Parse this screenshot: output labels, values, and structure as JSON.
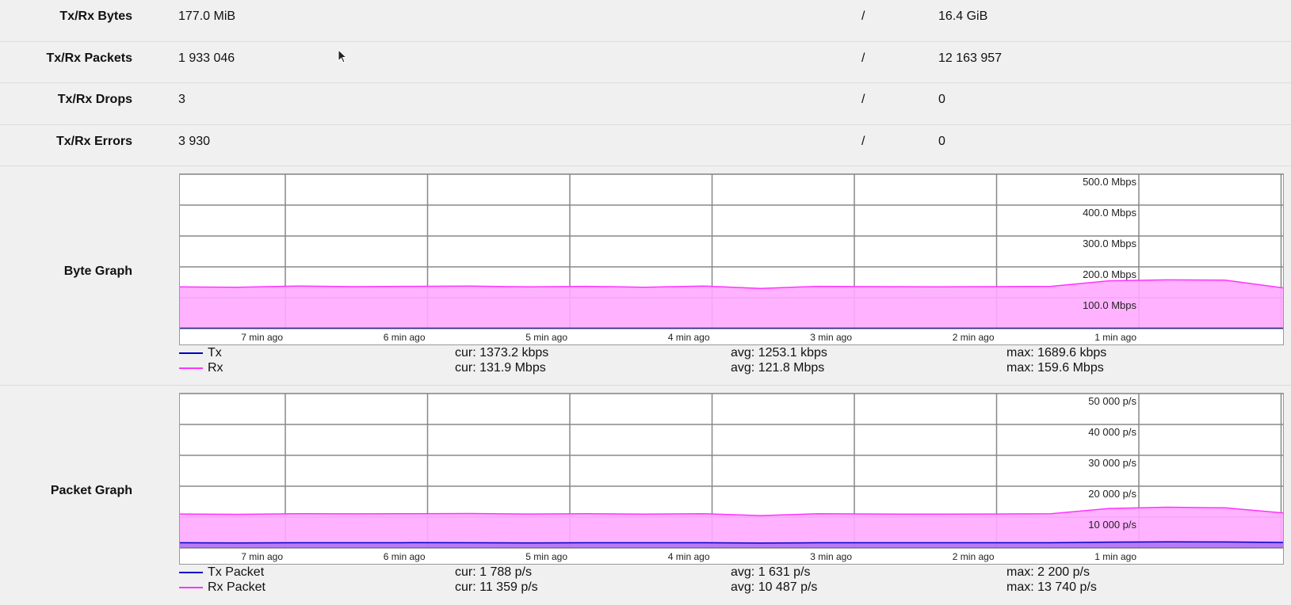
{
  "stats": [
    {
      "label": "Tx/Rx Bytes",
      "tx": "177.0 MiB",
      "sep": "/",
      "rx": "16.4 GiB"
    },
    {
      "label": "Tx/Rx Packets",
      "tx": "1 933 046",
      "sep": "/",
      "rx": "12 163 957"
    },
    {
      "label": "Tx/Rx Drops",
      "tx": "3",
      "sep": "/",
      "rx": "0"
    },
    {
      "label": "Tx/Rx Errors",
      "tx": "3 930",
      "sep": "/",
      "rx": "0"
    }
  ],
  "colors": {
    "tx": "#0000cc",
    "rx": "#ff33ff",
    "rx_fill": "#ffaaff",
    "grid": "#888888"
  },
  "byte_graph": {
    "label": "Byte Graph",
    "y_ticks": [
      "500.0 Mbps",
      "400.0 Mbps",
      "300.0 Mbps",
      "200.0 Mbps",
      "100.0 Mbps"
    ],
    "x_ticks": [
      "7 min ago",
      "6 min ago",
      "5 min ago",
      "4 min ago",
      "3 min ago",
      "2 min ago",
      "1 min ago"
    ],
    "legend": [
      {
        "name": "Tx",
        "cur": "cur: 1373.2 kbps",
        "avg": "avg: 1253.1 kbps",
        "max": "max: 1689.6 kbps"
      },
      {
        "name": "Rx",
        "cur": "cur: 131.9 Mbps",
        "avg": "avg: 121.8 Mbps",
        "max": "max: 159.6 Mbps"
      }
    ]
  },
  "packet_graph": {
    "label": "Packet Graph",
    "y_ticks": [
      "50 000 p/s",
      "40 000 p/s",
      "30 000 p/s",
      "20 000 p/s",
      "10 000 p/s"
    ],
    "x_ticks": [
      "7 min ago",
      "6 min ago",
      "5 min ago",
      "4 min ago",
      "3 min ago",
      "2 min ago",
      "1 min ago"
    ],
    "legend": [
      {
        "name": "Tx Packet",
        "cur": "cur: 1 788 p/s",
        "avg": "avg: 1 631 p/s",
        "max": "max: 2 200 p/s"
      },
      {
        "name": "Rx Packet",
        "cur": "cur: 11 359 p/s",
        "avg": "avg: 10 487 p/s",
        "max": "max: 13 740 p/s"
      }
    ]
  },
  "chart_data": [
    {
      "type": "area",
      "title": "Byte Graph",
      "ylim": [
        0,
        500
      ],
      "yunit": "Mbps",
      "x_categories": [
        "7 min ago",
        "6 min ago",
        "5 min ago",
        "4 min ago",
        "3 min ago",
        "2 min ago",
        "1 min ago"
      ],
      "grid": true,
      "series": [
        {
          "name": "Tx",
          "values": [
            1.3,
            1.3,
            1.3,
            1.3,
            1.3,
            1.3,
            1.3,
            1.3,
            1.3,
            1.3,
            1.3,
            1.3,
            1.3,
            1.3,
            1.3,
            1.3,
            1.4,
            1.3,
            1.3,
            1.4
          ]
        },
        {
          "name": "Rx",
          "values": [
            135,
            134,
            138,
            136,
            137,
            138,
            135,
            137,
            134,
            138,
            130,
            137,
            136,
            135,
            136,
            137,
            155,
            158,
            157,
            132
          ]
        }
      ]
    },
    {
      "type": "area",
      "title": "Packet Graph",
      "ylim": [
        0,
        50000
      ],
      "yunit": "p/s",
      "x_categories": [
        "7 min ago",
        "6 min ago",
        "5 min ago",
        "4 min ago",
        "3 min ago",
        "2 min ago",
        "1 min ago"
      ],
      "grid": true,
      "series": [
        {
          "name": "Tx Packet",
          "values": [
            1700,
            1650,
            1700,
            1680,
            1720,
            1700,
            1650,
            1700,
            1680,
            1700,
            1600,
            1700,
            1690,
            1700,
            1680,
            1700,
            1900,
            2000,
            1950,
            1788
          ]
        },
        {
          "name": "Rx Packet",
          "values": [
            11000,
            10900,
            11100,
            11050,
            11100,
            11150,
            11000,
            11100,
            10950,
            11100,
            10500,
            11100,
            11000,
            10950,
            11000,
            11100,
            12800,
            13200,
            13000,
            11359
          ]
        }
      ]
    }
  ]
}
